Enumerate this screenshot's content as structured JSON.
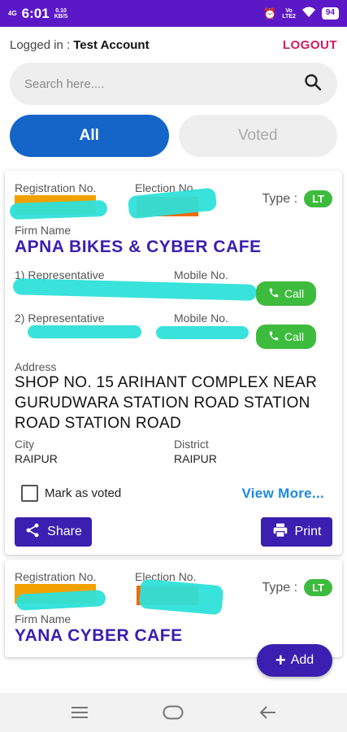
{
  "status_bar": {
    "network": "4G",
    "time": "6:01",
    "speed_value": "0.10",
    "speed_unit": "KB/S",
    "volte": "Vo\nLTE2",
    "battery": "94"
  },
  "header": {
    "logged_in_label": "Logged in :",
    "account_name": "Test Account",
    "logout_label": "LOGOUT"
  },
  "search": {
    "placeholder": "Search here...."
  },
  "tabs": [
    {
      "label": "All",
      "active": true
    },
    {
      "label": "Voted",
      "active": false
    }
  ],
  "cards": [
    {
      "registration_label": "Registration No.",
      "election_label": "Election No.",
      "type_label": "Type :",
      "type_value": "LT",
      "firm_name_label": "Firm Name",
      "firm_name": "APNA BIKES & CYBER CAFE",
      "rep1_label": "1) Representative",
      "rep2_label": "2) Representative",
      "mobile_label": "Mobile No.",
      "call_label": "Call",
      "address_label": "Address",
      "address": "SHOP NO. 15 ARIHANT COMPLEX NEAR GURUDWARA STATION ROAD STATION ROAD STATION ROAD",
      "city_label": "City",
      "city": "RAIPUR",
      "district_label": "District",
      "district": "RAIPUR",
      "mark_voted_label": "Mark as voted",
      "view_more_label": "View More...",
      "share_label": "Share",
      "print_label": "Print"
    },
    {
      "registration_label": "Registration No.",
      "election_label": "Election No.",
      "type_label": "Type :",
      "type_value": "LT",
      "firm_name_label": "Firm Name",
      "firm_name": "YANA CYBER CAFE"
    }
  ],
  "fab": {
    "label": "Add"
  },
  "colors": {
    "status_bar": "#5b18c7",
    "primary": "#3a1fb0",
    "tab_active": "#1565c8",
    "call_green": "#3dbb3d",
    "logout": "#d6195b",
    "link_blue": "#1e88e5"
  },
  "icons": [
    "search-icon",
    "phone-icon",
    "share-icon",
    "print-icon",
    "plus-icon",
    "menu-icon",
    "home-icon",
    "back-icon"
  ]
}
